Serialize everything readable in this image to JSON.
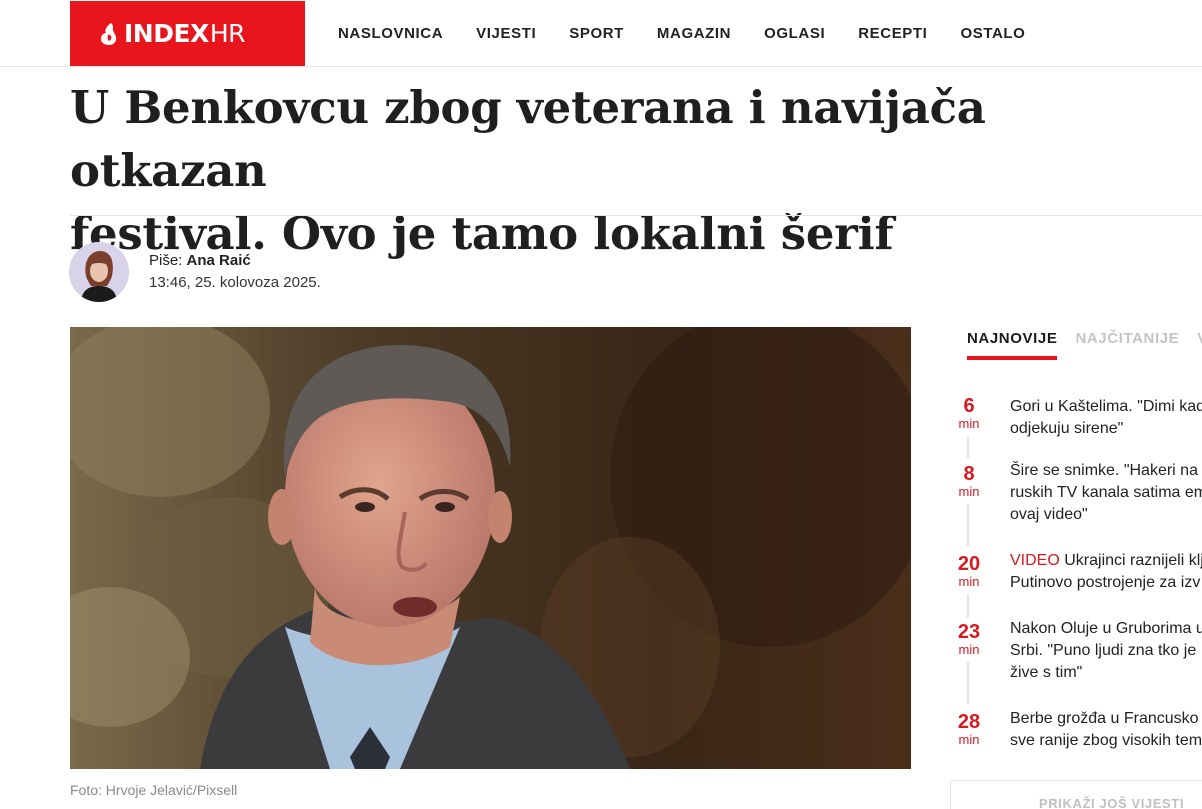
{
  "logo": {
    "main": "INDEX",
    "suffix": "HR"
  },
  "nav": [
    {
      "label": "NASLOVNICA"
    },
    {
      "label": "VIJESTI"
    },
    {
      "label": "SPORT"
    },
    {
      "label": "MAGAZIN"
    },
    {
      "label": "OGLASI"
    },
    {
      "label": "RECEPTI"
    },
    {
      "label": "OSTALO"
    }
  ],
  "article": {
    "title_line1": "U Benkovcu zbog veterana i navijača otkazan",
    "title_line2": "festival. Ovo je tamo lokalni šerif",
    "author_prefix": "Piše: ",
    "author_name": "Ana Raić",
    "date": "13:46, 25. kolovoza 2025.",
    "photo_caption": "Foto: Hrvoje Jelavić/Pixsell"
  },
  "sidebar": {
    "tabs": [
      {
        "label": "NAJNOVIJE"
      },
      {
        "label": "NAJČITANIJE"
      },
      {
        "label": "V"
      }
    ],
    "news": [
      {
        "num": "6",
        "unit": "min",
        "tag": "",
        "lines": [
          "Gori u Kaštelima. \"Dimi kad",
          "odjekuju sirene\""
        ]
      },
      {
        "num": "8",
        "unit": "min",
        "tag": "",
        "lines": [
          "Šire se snimke. \"Hakeri na",
          "ruskih TV kanala satima em",
          "ovaj video\""
        ]
      },
      {
        "num": "20",
        "unit": "min",
        "tag": "VIDEO",
        "lines": [
          " Ukrajinci raznijeli klj",
          "Putinovo postrojenje za izv"
        ]
      },
      {
        "num": "23",
        "unit": "min",
        "tag": "",
        "lines": [
          "Nakon Oluje u Gruborima u",
          "Srbi. \"Puno ljudi zna tko je",
          "žive s tim\""
        ]
      },
      {
        "num": "28",
        "unit": "min",
        "tag": "",
        "lines": [
          "Berbe grožđa u Francusko",
          "sve ranije zbog visokih tem"
        ]
      }
    ],
    "more_label": "PRIKAŽI JOŠ VIJESTI"
  },
  "colors": {
    "brand_red": "#e8161c",
    "accent_red": "#d71920"
  },
  "icons": [
    "flame-logo-icon"
  ]
}
